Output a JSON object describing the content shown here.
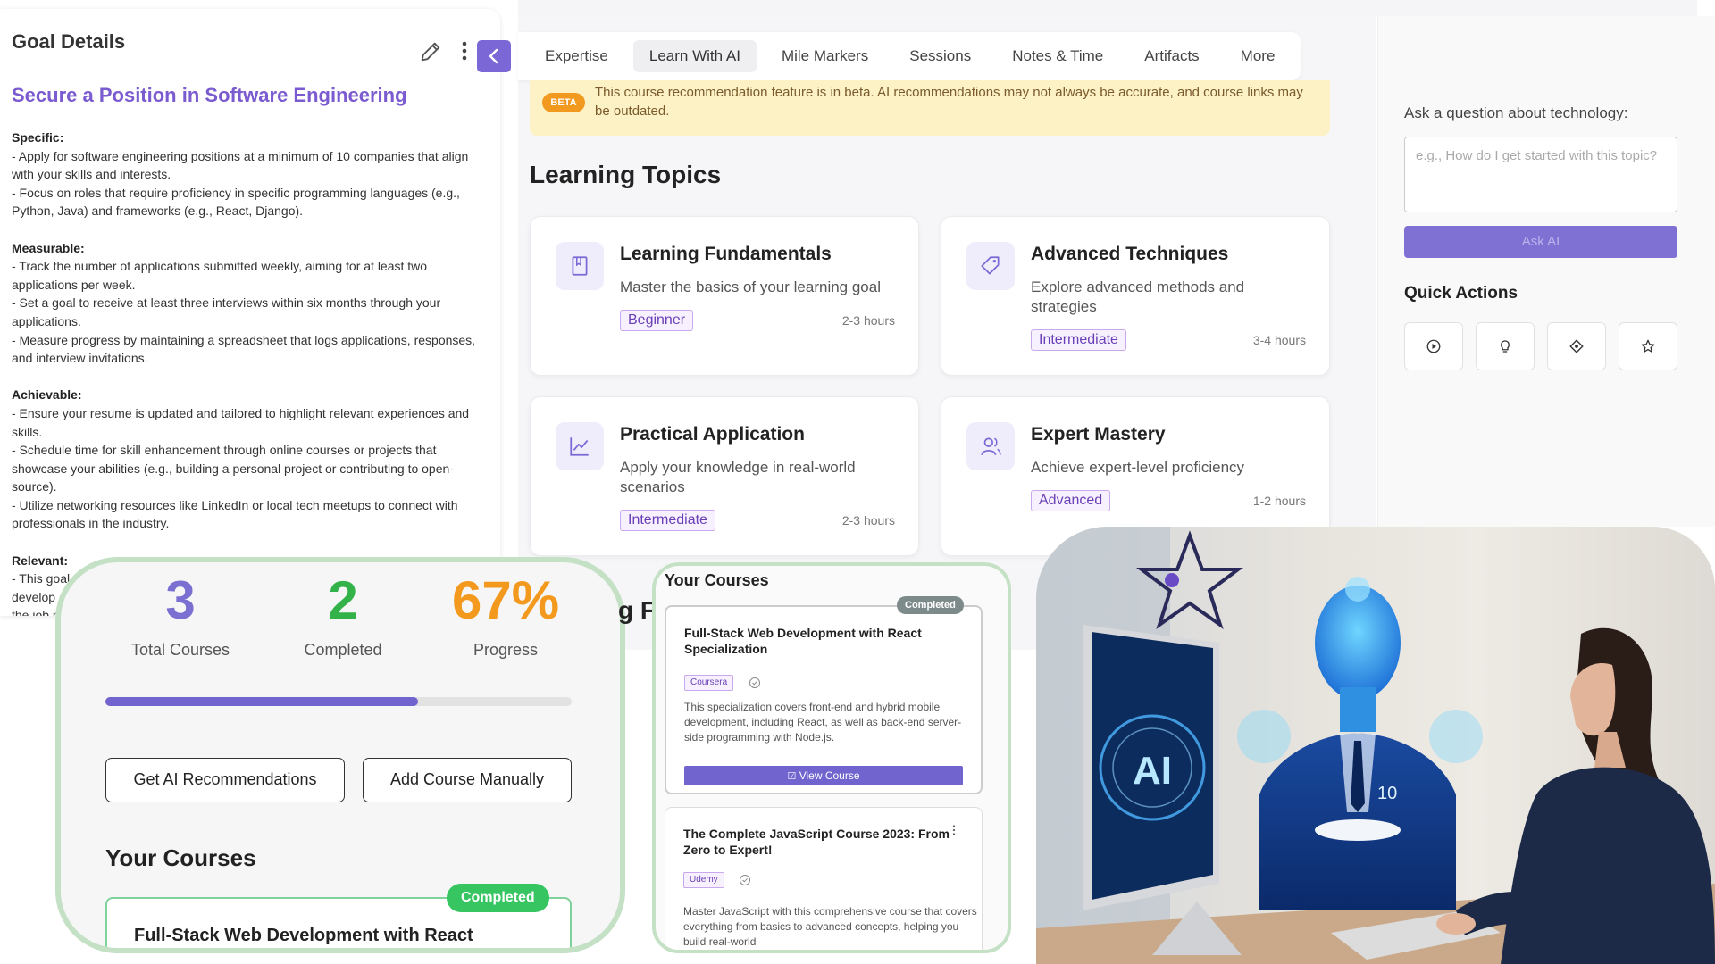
{
  "goal_panel": {
    "header": "Goal Details",
    "goal_title": "Secure a Position in Software Engineering",
    "sections": [
      {
        "heading": "Specific:",
        "lines": [
          "- Apply for software engineering positions at a minimum of 10 companies that align with your skills and interests.",
          "- Focus on roles that require proficiency in specific programming languages (e.g., Python, Java) and frameworks (e.g., React, Django)."
        ]
      },
      {
        "heading": "Measurable:",
        "lines": [
          "- Track the number of applications submitted weekly, aiming for at least two applications per week.",
          "- Set a goal to receive at least three interviews within six months through your applications.",
          "- Measure progress by maintaining a spreadsheet that logs applications, responses, and interview invitations."
        ]
      },
      {
        "heading": "Achievable:",
        "lines": [
          "- Ensure your resume is updated and tailored to highlight relevant experiences and skills.",
          "- Schedule time for skill enhancement through online courses or projects that showcase your abilities (e.g., building a personal project or contributing to open-source).",
          "- Utilize networking resources like LinkedIn or local tech meetups to connect with professionals in the industry."
        ]
      },
      {
        "heading": "Relevant:",
        "lines": [
          "- This goal ali",
          "develop a",
          "the job m"
        ]
      }
    ]
  },
  "tabs": [
    "Expertise",
    "Learn With AI",
    "Mile Markers",
    "Sessions",
    "Notes & Time",
    "Artifacts",
    "More"
  ],
  "active_tab": "Learn With AI",
  "beta": {
    "badge": "BETA",
    "text": "This course recommendation feature is in beta. AI recommendations may not always be accurate, and course links may be outdated."
  },
  "learning_topics": {
    "title": "Learning Topics",
    "cards": [
      {
        "name": "Learning Fundamentals",
        "desc": "Master the basics of your learning goal",
        "level": "Beginner",
        "hours": "2-3 hours",
        "icon": "book-icon"
      },
      {
        "name": "Advanced Techniques",
        "desc": "Explore advanced methods and strategies",
        "level": "Intermediate",
        "hours": "3-4 hours",
        "icon": "tag-icon"
      },
      {
        "name": "Practical Application",
        "desc": "Apply your knowledge in real-world scenarios",
        "level": "Intermediate",
        "hours": "2-3 hours",
        "icon": "chart-line-icon"
      },
      {
        "name": "Expert Mastery",
        "desc": "Achieve expert-level proficiency",
        "level": "Advanced",
        "hours": "1-2 hours",
        "icon": "users-icon"
      }
    ]
  },
  "ask_ai": {
    "label": "Ask a question about technology:",
    "placeholder": "e.g., How do I get started with this topic?",
    "button": "Ask AI",
    "quick_actions_title": "Quick Actions",
    "quick_actions": [
      "play-circle-icon",
      "lightbulb-icon",
      "target-icon",
      "star-icon"
    ]
  },
  "stats": {
    "total": "3",
    "total_label": "Total Courses",
    "completed": "2",
    "completed_label": "Completed",
    "progress": "67%",
    "progress_label": "Progress",
    "progress_fraction": 0.67,
    "btn_ai": "Get AI Recommendations",
    "btn_manual": "Add Course Manually",
    "your_courses": "Your Courses",
    "card_title": "Full-Stack Web Development with React",
    "card_badge": "Completed",
    "colors": {
      "total": "#7b6fd1",
      "completed": "#33b24a",
      "progress": "#f39a1e"
    }
  },
  "courses_panel": {
    "title": "Your Courses",
    "peek_text": "g F",
    "courses": [
      {
        "name": "Full-Stack Web Development with React Specialization",
        "platform": "Coursera",
        "badge": "Completed",
        "desc": "This specialization covers front-end and hybrid mobile development, including React, as well as back-end server-side programming with Node.js.",
        "button": "View Course"
      },
      {
        "name": "The Complete JavaScript Course 2023: From Zero to Expert!",
        "platform": "Udemy",
        "desc": "Master JavaScript with this comprehensive course that covers everything from basics to advanced concepts, helping you build real-world"
      }
    ]
  },
  "illustration": {
    "screen_text": "AI",
    "suit_text": "10"
  }
}
